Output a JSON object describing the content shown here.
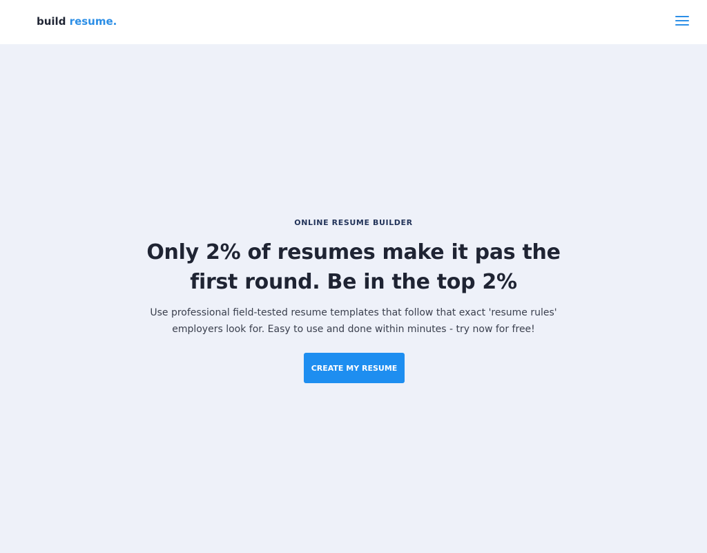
{
  "navbar": {
    "brand_part1": "build",
    "brand_part2": "resume.",
    "menu_icon": "hamburger-menu-icon"
  },
  "hero": {
    "eyebrow": "ONLINE RESUME BUILDER",
    "headline": "Only 2% of resumes make it pas the first round. Be in the top 2%",
    "subtext": "Use professional field-tested resume templates that follow that exact 'resume rules' employers look for. Easy to use and done within minutes - try now for free!",
    "cta_label": "CREATE MY RESUME"
  },
  "colors": {
    "accent": "#2b8ee6",
    "button": "#1e8ef0",
    "background": "#eef1f9",
    "header_bg": "#ffffff",
    "text_dark": "#1f2433"
  }
}
